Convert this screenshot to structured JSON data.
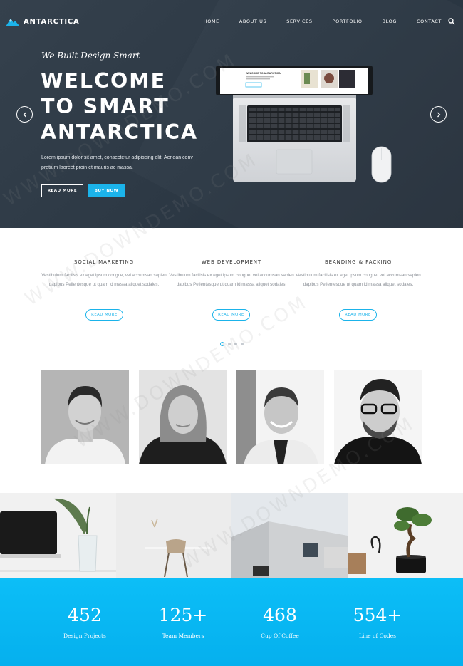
{
  "brand": {
    "name": "ANTARCTICA",
    "accent": "#1bb3ea",
    "hero_bg": "#2f3b47"
  },
  "nav": {
    "items": [
      "HOME",
      "ABOUT US",
      "SERVICES",
      "PORTFOLIO",
      "BLOG",
      "CONTACT"
    ],
    "search_icon": "search-icon"
  },
  "hero": {
    "tagline": "We Built Design Smart",
    "headline": [
      "WELCOME",
      "TO SMART",
      "ANTARCTICA"
    ],
    "description": "Lorem ipsum dolor sit amet, consectetur adipiscing elit. Aenean conv pretium laoreet proin et mauris ac massa.",
    "read_more": "READ MORE",
    "buy_now": "BUY NOW",
    "screen_title": "WELCOME TO ANTARCTICA"
  },
  "services": [
    {
      "title": "SOCIAL MARKETING",
      "description": "Vestibulum facilisis ex eget ipsum congue, vel accumsan sapien dapibus Pellentesque ut quam id massa aliquet sodales.",
      "button": "READ MORE"
    },
    {
      "title": "WEB DEVELOPMENT",
      "description": "Vestibulum facilisis ex eget ipsum congue, vel accumsan sapien dapibus Pellentesque ut quam id massa aliquet sodales.",
      "button": "READ MORE"
    },
    {
      "title": "BEANDING & PACKING",
      "description": "Vestibulum facilisis ex eget ipsum congue, vel accumsan sapien dapibus Pellentesque ut quam id massa aliquet sodales.",
      "button": "READ MORE"
    }
  ],
  "slider": {
    "dot_count": 4,
    "active_index": 0
  },
  "stats": [
    {
      "number": "452",
      "label": "Design Projects"
    },
    {
      "number": "125+",
      "label": "Team Members"
    },
    {
      "number": "468",
      "label": "Cup Of Coffee"
    },
    {
      "number": "554+",
      "label": "Line of Codes"
    }
  ],
  "watermark": "WWW.DOWNDEMO.COM"
}
